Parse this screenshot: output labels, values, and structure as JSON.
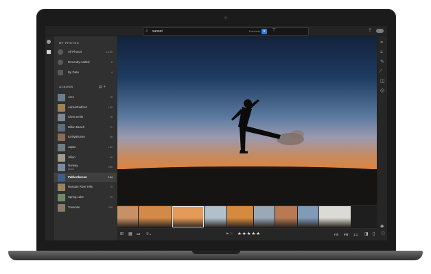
{
  "search": {
    "query": "sunset",
    "products_label": "Products",
    "filter_pill": "▾"
  },
  "sidebar": {
    "my_photos_title": "MY PHOTOS",
    "my_photos": [
      {
        "label": "All Photos",
        "count": "1,155"
      },
      {
        "label": "Recently Added",
        "count": "6"
      },
      {
        "label": "By Date",
        "count": "4"
      }
    ],
    "albums_title": "ALBUMS",
    "albums": [
      {
        "label": "Acro",
        "count": "78",
        "sub": "",
        "color": "#6a7d8f"
      },
      {
        "label": "AdrienRadford",
        "count": "198",
        "sub": "",
        "color": "#a08256"
      },
      {
        "label": "Chris Smith",
        "count": "76",
        "sub": "",
        "color": "#7c8794"
      },
      {
        "label": "Dillon Beach",
        "count": "71",
        "sub": "",
        "color": "#5b6e7a"
      },
      {
        "label": "EmilyBitonse",
        "count": "96",
        "sub": "",
        "color": "#8c6b57"
      },
      {
        "label": "Japan",
        "count": "161",
        "sub": "",
        "color": "#6f7d82"
      },
      {
        "label": "Jillian",
        "count": "90",
        "sub": "",
        "color": "#a09a92"
      },
      {
        "label": "Norway",
        "count": "256",
        "sub": "Beach",
        "color": "#7a8aa0"
      },
      {
        "label": "PabloAlarcon",
        "count": "144",
        "sub": "",
        "color": "#3c5e8a"
      },
      {
        "label": "Russian River Hills",
        "count": "75",
        "sub": "",
        "color": "#9a8460"
      },
      {
        "label": "Spring Lake",
        "count": "76",
        "sub": "",
        "color": "#6f8a6a"
      },
      {
        "label": "Yosemite",
        "count": "206",
        "sub": "",
        "color": "#8a7c6a"
      }
    ],
    "selected_album_index": 8
  },
  "filmstrip": {
    "thumb_colors": [
      "#c89066",
      "#d28a48",
      "#e39b57",
      "#b2c0cc",
      "#d68a3e",
      "#9aa8b8",
      "#b77a52",
      "#7f9bb8",
      "#dcdad4"
    ],
    "selected_index": 2
  },
  "toolbar": {
    "stars": "★★★★★",
    "pick_label": "⚑ ⚐",
    "fit_label": "FIT",
    "ratio_label": "1:1",
    "fill_label": "Fill"
  },
  "colors": {
    "accent": "#2f7fd6",
    "panel": "#303030",
    "background": "#2b2b2b"
  }
}
